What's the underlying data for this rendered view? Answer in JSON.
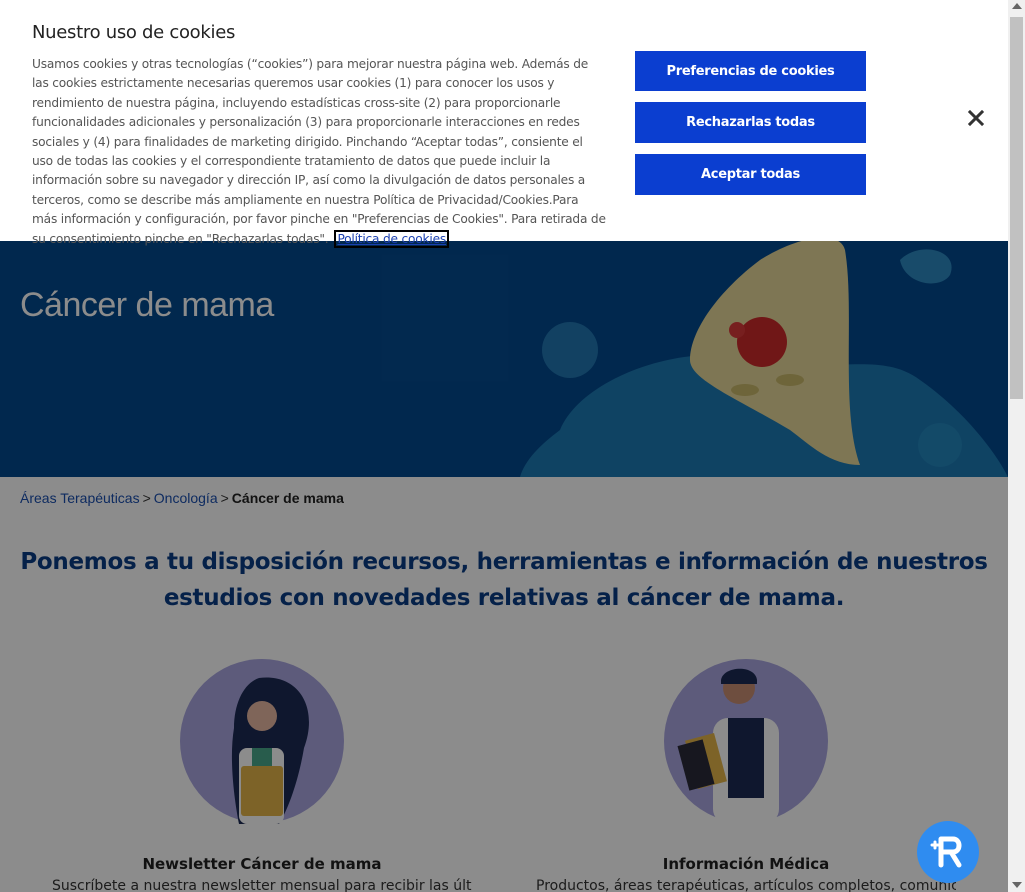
{
  "hero": {
    "title": "Cáncer de mama"
  },
  "breadcrumb": {
    "items": [
      "Áreas Terapéuticas",
      "Oncología"
    ],
    "separator": ">",
    "current": "Cáncer de mama"
  },
  "intro": "Ponemos a tu disposición recursos, herramientas e información de nuestros estudios con novedades relativas al cáncer de mama.",
  "cards": [
    {
      "title": "Newsletter Cáncer de mama",
      "text": "Suscríbete a nuestra newsletter mensual para recibir las últimas"
    },
    {
      "title": "Información Médica",
      "text": "Productos, áreas terapéuticas, artículos completos, comunicaciones de"
    }
  ],
  "cookie": {
    "title": "Nuestro uso de cookies",
    "body": "Usamos cookies y otras tecnologías (“cookies”) para mejorar nuestra página web. Además de las cookies estrictamente necesarias queremos usar cookies (1) para conocer los usos y rendimiento de nuestra página, incluyendo estadísticas cross-site (2) para proporcionarle funcionalidades adicionales y personalización (3) para proporcionarle interacciones en redes sociales y (4) para finalidades de marketing dirigido. Pinchando “Aceptar todas”, consiente el uso de todas las cookies y el correspondiente tratamiento de datos que puede incluir la información sobre su navegador y dirección IP, así como la divulgación de datos personales a terceros, como se describe más ampliamente en nuestra Política de Privacidad/Cookies.Para más información y configuración, por favor pinche en \"Preferencias de Cookies\". Para retirada de su consentimiento pinche en \"Rechazarlas todas\".",
    "policy_link": "Política de cookies",
    "btn_preferences": "Preferencias de cookies",
    "btn_reject": "Rechazarlas todas",
    "btn_accept": "Aceptar todas",
    "close_icon": "close-icon"
  },
  "colors": {
    "hero_bg": "#034a8f",
    "heading": "#0a3c86",
    "button": "#0b3ed0",
    "chat": "#2f8cf0"
  }
}
